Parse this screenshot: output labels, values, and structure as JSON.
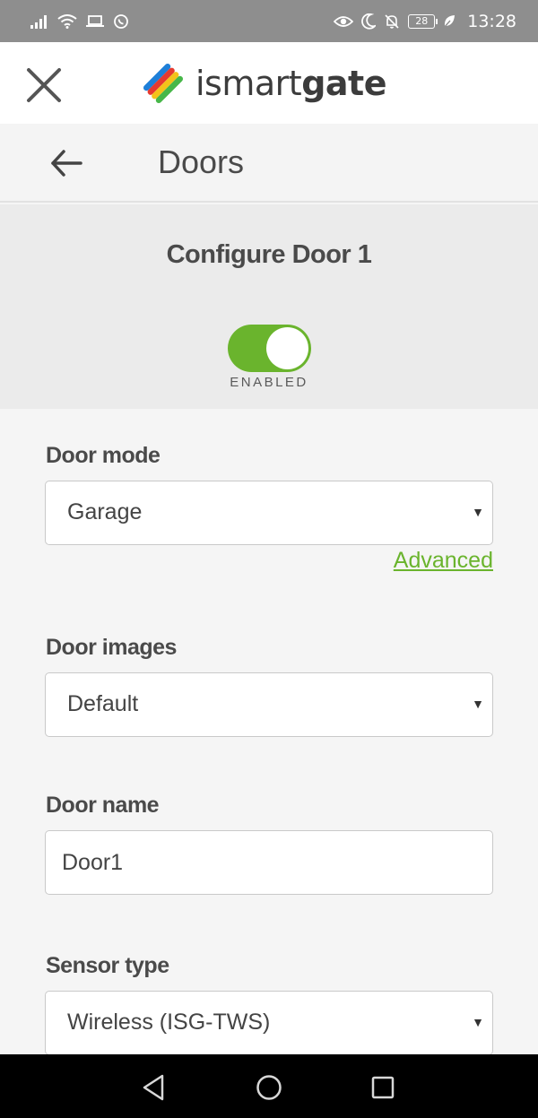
{
  "status_bar": {
    "time": "13:28",
    "battery_level": "28",
    "icons": [
      "signal-icon",
      "wifi-icon",
      "laptop-icon",
      "whatsapp-icon",
      "eye-icon",
      "moon-icon",
      "bell-off-icon",
      "battery-icon",
      "leaf-icon"
    ]
  },
  "header": {
    "logo_text_light": "ismart",
    "logo_text_bold": "gate"
  },
  "nav": {
    "title": "Doors"
  },
  "config": {
    "title": "Configure Door 1",
    "toggle_label": "ENABLED",
    "toggle_on": true
  },
  "form": {
    "door_mode": {
      "label": "Door mode",
      "value": "Garage",
      "advanced_link": "Advanced"
    },
    "door_images": {
      "label": "Door images",
      "value": "Default"
    },
    "door_name": {
      "label": "Door name",
      "value": "Door1"
    },
    "sensor_type": {
      "label": "Sensor type",
      "value": "Wireless (ISG-TWS)"
    }
  },
  "colors": {
    "accent_green": "#6ab42d",
    "status_bar": "#8e8e8e",
    "text_dark": "#4a4a4a"
  }
}
